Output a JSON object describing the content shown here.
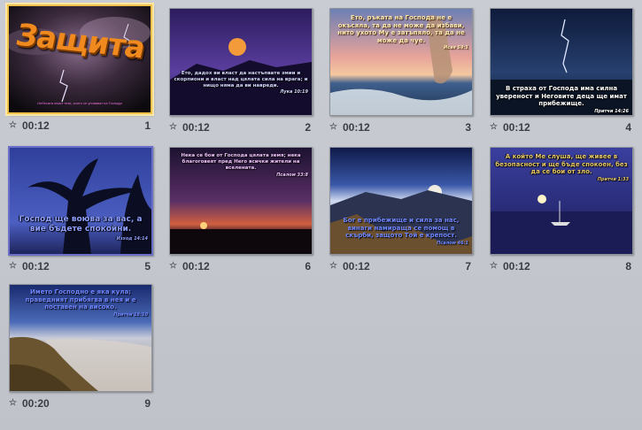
{
  "slides": [
    {
      "number": "1",
      "time": "00:12",
      "transition_icon": "star-icon",
      "title": "Защита",
      "subtitle": "Небесата пазят тези, които се уповават на Господа"
    },
    {
      "number": "2",
      "time": "00:12",
      "transition_icon": "star-icon",
      "text": "Ето, дадох ви власт да настъпвате змии и скорпиони и власт над цялата сила на врага; и нищо няма да ви навреди.",
      "ref": "Лука 10:19"
    },
    {
      "number": "3",
      "time": "00:12",
      "transition_icon": "star-icon",
      "text": "Ето, ръката на Господа не е окъсяла, та да не може да избави, нито ухото Му е затъпяло, та да не може да чуе.",
      "ref": "Исая 59:1"
    },
    {
      "number": "4",
      "time": "00:12",
      "transition_icon": "star-icon",
      "text": "В страха от Господа има силна увереност и Неговите деца ще имат прибежище.",
      "ref": "Притчи 14:26"
    },
    {
      "number": "5",
      "time": "00:12",
      "transition_icon": "star-icon",
      "text": "Господ ще воюва за вас, а вие бъдете спокойни.",
      "ref": "Изход 14:14"
    },
    {
      "number": "6",
      "time": "00:12",
      "transition_icon": "star-icon",
      "text": "Нека се бои от Господа цялата земя; нека благоговеят пред Него всички жители на вселената.",
      "ref": "Псалом 33:8"
    },
    {
      "number": "7",
      "time": "00:12",
      "transition_icon": "star-icon",
      "text": "Бог е прибежище и сила за нас, винаги намираща се помощ в скърби, защото Той е крепост.",
      "ref": "Псалом 46:1"
    },
    {
      "number": "8",
      "time": "00:12",
      "transition_icon": "star-icon",
      "text": "А който Ме слуша, ще живее в безопасност и ще бъде спокоен, без да се бои от зло.",
      "ref": "Притчи 1:33"
    },
    {
      "number": "9",
      "time": "00:20",
      "transition_icon": "star-icon",
      "text": "Името Господно е яка кула; праведният прибягва в нея и е поставен на високо.",
      "ref": "Притчи 18:10"
    }
  ]
}
